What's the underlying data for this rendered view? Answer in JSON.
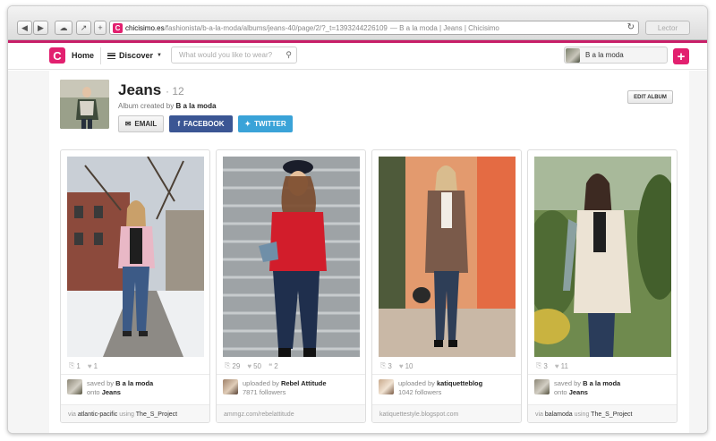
{
  "browser": {
    "url_domain": "chicisimo.es",
    "url_path": "/fashionista/b-a-la-moda/albums/jeans-40/page/2/?_t=1393244226109",
    "page_title": "— B a la moda | Jeans | Chicisimo",
    "reader_label": "Lector",
    "favicon_letter": "C"
  },
  "nav": {
    "logo_letter": "C",
    "home_label": "Home",
    "discover_label": "Discover",
    "search_placeholder": "What would you like to wear?",
    "user_name": "B a la moda",
    "add_label": "+"
  },
  "album": {
    "title": "Jeans",
    "count": "· 12",
    "created_prefix": "Album created by",
    "creator": "B a la moda",
    "email_label": "EMAIL",
    "facebook_label": "FACEBOOK",
    "twitter_label": "TWITTER",
    "edit_label": "EDIT ALBUM"
  },
  "cards": [
    {
      "saves": "1",
      "likes": "1",
      "comments": "",
      "line1_prefix": "saved by",
      "line1_name": "B a la moda",
      "line2_prefix": "onto",
      "line2_name": "Jeans",
      "foot_prefix": "via",
      "foot_source": "atlantic-pacific",
      "foot_mid": "using",
      "foot_app": "The_S_Project"
    },
    {
      "saves": "29",
      "likes": "50",
      "comments": "2",
      "line1_prefix": "uploaded by",
      "line1_name": "Rebel Attitude",
      "line2_prefix": "",
      "line2_name": "7871 followers",
      "foot_prefix": "",
      "foot_source": "ammgz.com/rebelattitude",
      "foot_mid": "",
      "foot_app": ""
    },
    {
      "saves": "3",
      "likes": "10",
      "comments": "",
      "line1_prefix": "uploaded by",
      "line1_name": "katiquetteblog",
      "line2_prefix": "",
      "line2_name": "1042 followers",
      "foot_prefix": "",
      "foot_source": "katiquettestyle.blogspot.com",
      "foot_mid": "",
      "foot_app": ""
    },
    {
      "saves": "3",
      "likes": "11",
      "comments": "",
      "line1_prefix": "saved by",
      "line1_name": "B a la moda",
      "line2_prefix": "onto",
      "line2_name": "Jeans",
      "foot_prefix": "via",
      "foot_source": "balamoda",
      "foot_mid": "using",
      "foot_app": "The_S_Project"
    }
  ],
  "colors": {
    "brand": "#e2206f",
    "facebook": "#3b5694",
    "twitter": "#3aa3d8"
  }
}
